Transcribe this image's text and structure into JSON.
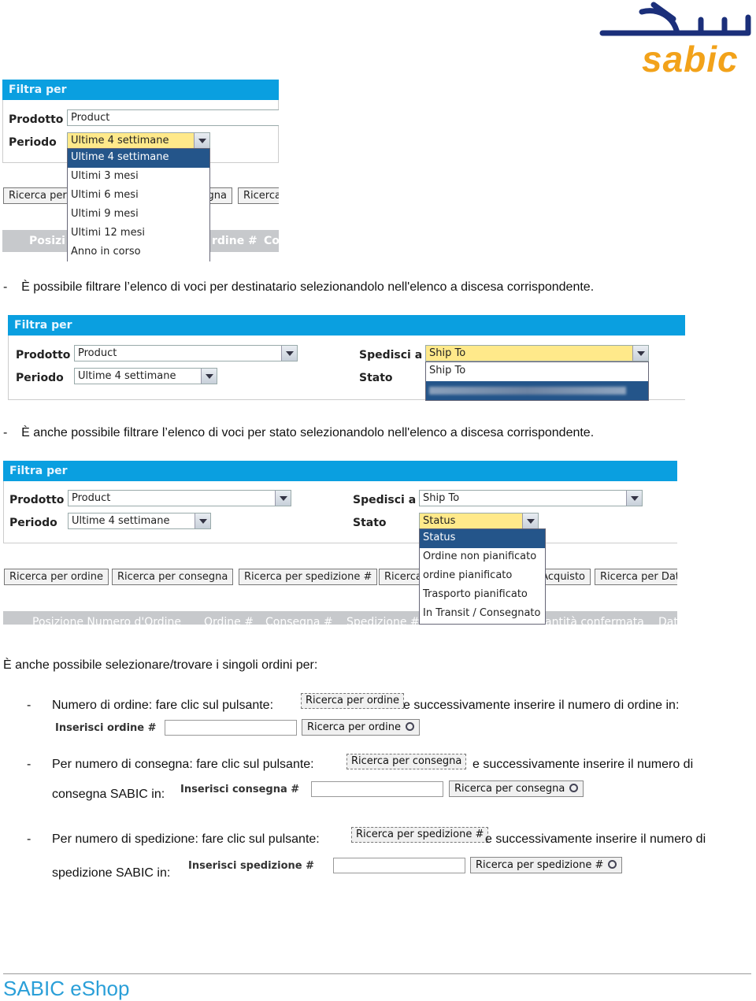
{
  "logo": {
    "text": "sabic",
    "arabic_color": "#1b2f7a",
    "latin_color": "#f2a21a"
  },
  "shot1": {
    "header": "Filtra per",
    "prodotto_label": "Prodotto",
    "prodotto_value": "Product",
    "periodo_label": "Periodo",
    "periodo_value": "Ultime 4 settimane",
    "options": [
      "Ultime 4 settimane",
      "Ultimi 3 mesi",
      "Ultimi 6 mesi",
      "Ultimi 9 mesi",
      "Ultimi 12 mesi",
      "Anno in corso"
    ],
    "buttons": [
      "Ricerca per ordine",
      "Ricerca per consegna",
      "Ricerca"
    ],
    "columns": [
      "Posizi",
      "rdine #",
      "Co"
    ]
  },
  "bullet1": "È possibile filtrare l’elenco di voci per destinatario selezionandolo nell'elenco a discesa corrispondente.",
  "shot2": {
    "header": "Filtra per",
    "prodotto_label": "Prodotto",
    "prodotto_value": "Product",
    "periodo_label": "Periodo",
    "periodo_value": "Ultime 4 settimane",
    "spedisci_label": "Spedisci a",
    "spedisci_value": "Ship To",
    "stato_label": "Stato",
    "options": [
      "Ship To",
      "(blurred ship-to entry)"
    ]
  },
  "bullet2": "È anche possibile filtrare l’elenco di voci per stato selezionandolo nell'elenco a discesa corrispondente.",
  "shot3": {
    "header": "Filtra per",
    "prodotto_label": "Prodotto",
    "prodotto_value": "Product",
    "periodo_label": "Periodo",
    "periodo_value": "Ultime 4 settimane",
    "spedisci_label": "Spedisci a",
    "spedisci_value": "Ship To",
    "stato_label": "Stato",
    "stato_value": "Status",
    "options": [
      "Status",
      "Ordine non pianificato",
      "ordine pianificato",
      "Trasporto pianificato",
      "In Transit / Consegnato"
    ],
    "buttons": [
      "Ricerca per ordine",
      "Ricerca per consegna",
      "Ricerca per spedizione #",
      "Ricerca",
      "Acquisto",
      "Ricerca per Dat"
    ],
    "columns": [
      "Posizione Numero d'Ordine",
      "Ordine #",
      "Consegna #",
      "Spedizione #",
      "antità confermata",
      "Dat"
    ]
  },
  "intro": "È anche possibile selezionare/trovare i singoli ordini per:",
  "items": [
    {
      "dash": "-",
      "text_a": "Numero di ordine: fare clic sul pulsante:",
      "button": "Ricerca per ordine",
      "text_b": "e successivamente inserire il numero di ordine in:",
      "text_c": "",
      "field_label": "Inserisci ordine #",
      "search_button": "Ricerca per ordine"
    },
    {
      "dash": "-",
      "text_a": "Per numero di consegna: fare clic sul pulsante:",
      "button": "Ricerca per consegna",
      "text_b": "e successivamente inserire il numero di",
      "text_c": "consegna SABIC in:",
      "field_label": "Inserisci consegna #",
      "search_button": "Ricerca per consegna"
    },
    {
      "dash": "-",
      "text_a": "Per numero di spedizione: fare clic sul pulsante:",
      "button": "Ricerca per spedizione #",
      "text_b": "e successivamente inserire il numero di",
      "text_c": "spedizione SABIC in:",
      "field_label": "Inserisci spedizione #",
      "search_button": "Ricerca per spedizione #"
    }
  ],
  "footer": {
    "title": "SABIC eShop",
    "color": "#2a9fd8"
  }
}
